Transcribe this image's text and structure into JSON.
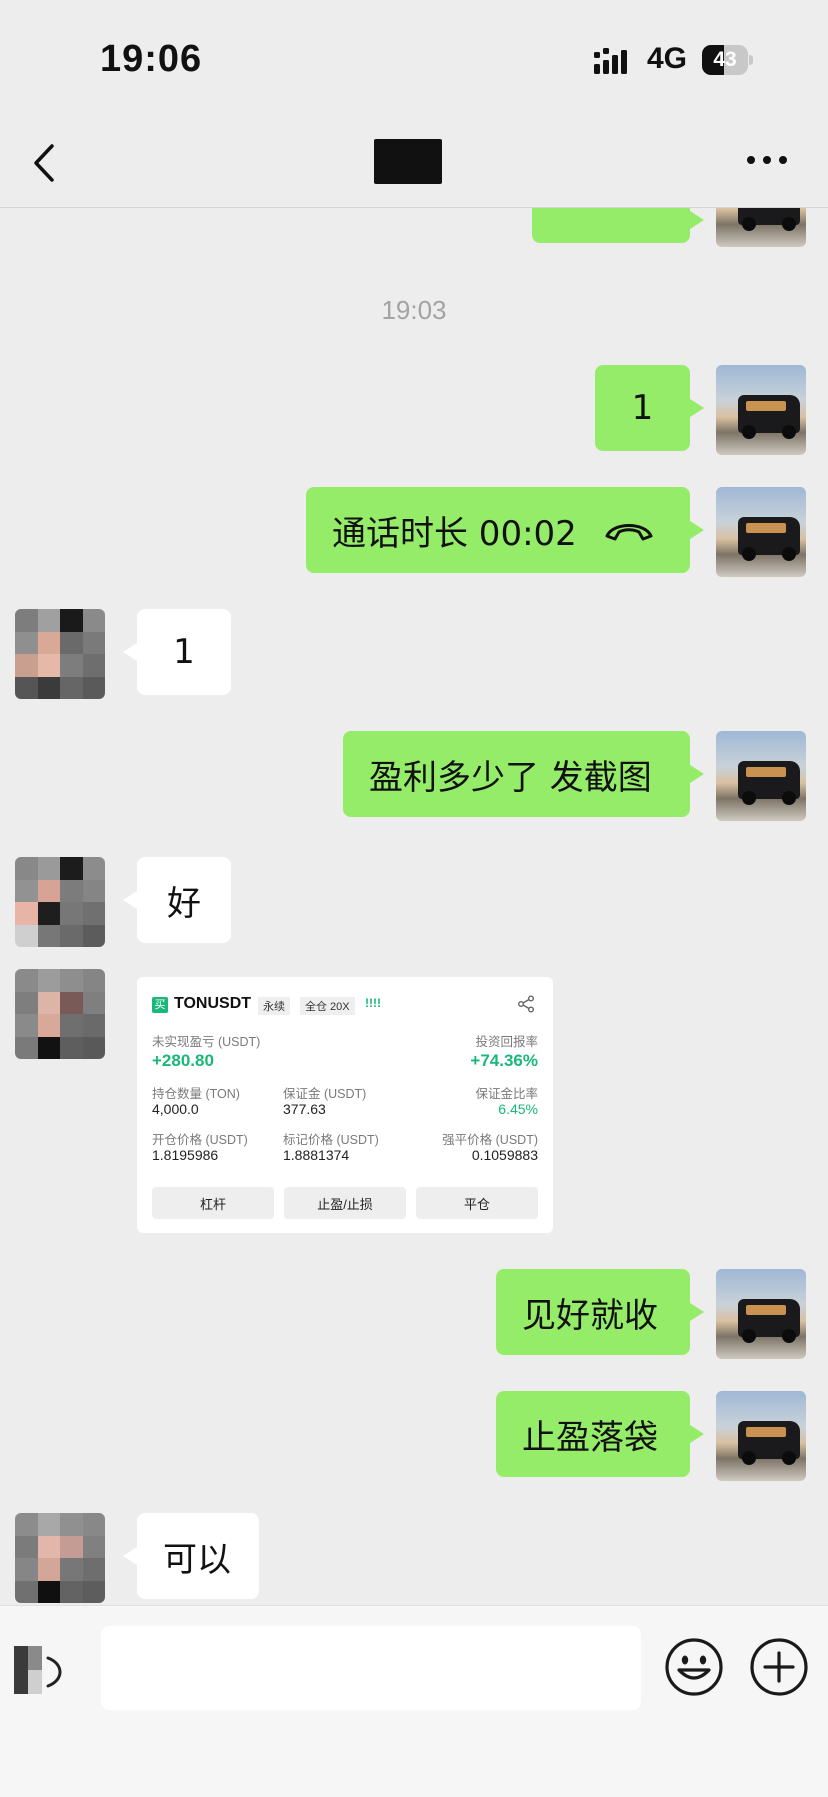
{
  "status_bar": {
    "time": "19:06",
    "network": "4G",
    "battery_level": "43"
  },
  "nav": {
    "title": ""
  },
  "messages": [
    {
      "type": "timestamp",
      "text": "19:03"
    },
    {
      "type": "sent",
      "text": "1"
    },
    {
      "type": "sent_call",
      "text": "通话时长 00:02"
    },
    {
      "type": "received",
      "text": "1"
    },
    {
      "type": "sent",
      "text": "盈利多少了 发截图"
    },
    {
      "type": "received",
      "text": "好"
    },
    {
      "type": "received_image"
    },
    {
      "type": "sent",
      "text": "见好就收"
    },
    {
      "type": "sent",
      "text": "止盈落袋"
    },
    {
      "type": "received",
      "text": "可以"
    }
  ],
  "trade_card": {
    "badge": "买",
    "symbol": "TONUSDT",
    "tag1": "永续",
    "tag2": "全仓 20X",
    "signal": "!!!!",
    "pnl_label": "未实现盈亏 (USDT)",
    "pnl_value": "+280.80",
    "roi_label": "投资回报率",
    "roi_value": "+74.36%",
    "size_label": "持仓数量 (TON)",
    "size_value": "4,000.0",
    "margin_label": "保证金 (USDT)",
    "margin_value": "377.63",
    "margin_ratio_label": "保证金比率",
    "margin_ratio_value": "6.45%",
    "entry_label": "开仓价格 (USDT)",
    "entry_value": "1.8195986",
    "mark_label": "标记价格 (USDT)",
    "mark_value": "1.8881374",
    "liq_label": "强平价格 (USDT)",
    "liq_value": "0.1059883",
    "btn_leverage": "杠杆",
    "btn_tpsl": "止盈/止损",
    "btn_close": "平仓"
  },
  "input": {
    "placeholder": ""
  },
  "colors": {
    "sent_bubble": "#95ec69",
    "received_bubble": "#ffffff",
    "background": "#ededed",
    "profit_green": "#19b87a"
  },
  "icons": [
    "back-icon",
    "more-icon",
    "voice-icon",
    "emoji-icon",
    "plus-icon",
    "phone-hangup-icon",
    "share-icon"
  ]
}
